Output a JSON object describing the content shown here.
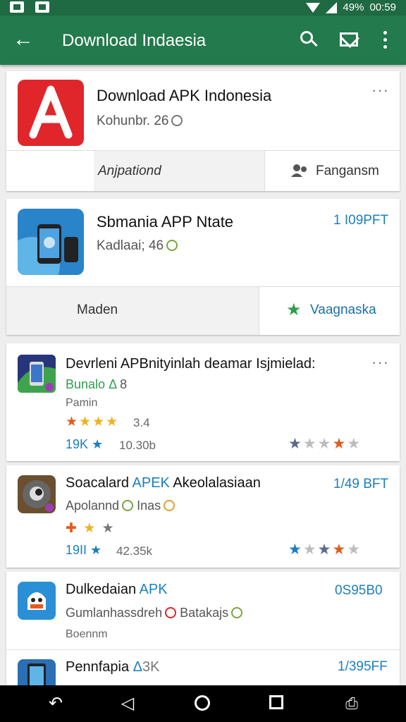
{
  "status_bar": {
    "battery": "49%",
    "time": "00:59"
  },
  "app_bar": {
    "title": "Download Indaesia"
  },
  "cards": {
    "c1": {
      "name": "Download APK Indonesia",
      "sub": "Kohunbr. 26",
      "left_action": "Anjpationd",
      "right_action": "Fangansm"
    },
    "c2": {
      "name": "Sbmania APP Ntate",
      "sub": "Kadlaai; 46",
      "price": "1 I09PFT",
      "left_action": "Maden",
      "right_action": "Vaagnaska"
    },
    "c3": {
      "name": "Devrleni APBnityinlah deamar Isjmielad:",
      "sub_green": "Bunalo",
      "sub_rest": "8",
      "category": "Pamin",
      "rating": "3.4",
      "count": "19K",
      "size": "10.30b"
    },
    "c4": {
      "name_a": "Soacalard",
      "name_b": "APEK",
      "name_c": "Akeolalasiaan",
      "price": "1/49 BFT",
      "sub_a": "Apolannd",
      "sub_b": "Inas",
      "count": "19II",
      "size": "42.35k"
    },
    "c5": {
      "name_a": "Dulkedaian",
      "name_b": "APK",
      "price": "0S95B0",
      "sub_a": "Gumlanhassdreh",
      "sub_b": "Batakajs",
      "category": "Boennm"
    },
    "c6": {
      "name_a": "Pennfapia",
      "name_b": "3K",
      "price": "1/395FF"
    }
  },
  "colors": {
    "appbar": "#237a4c",
    "statusbar": "#1f6a43",
    "accent_blue": "#1a7fc0",
    "red_icon": "#e0262b"
  }
}
